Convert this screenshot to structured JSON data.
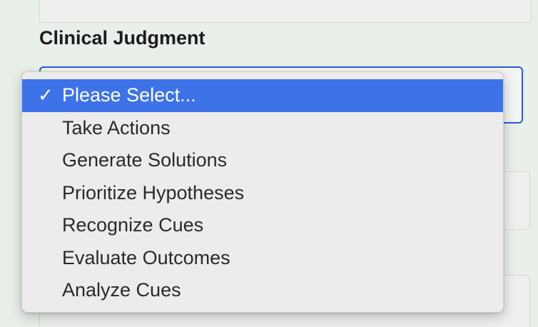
{
  "form": {
    "section_label": "Clinical Judgment"
  },
  "dropdown": {
    "selected_index": 0,
    "options": [
      {
        "label": "Please Select...",
        "selected": true
      },
      {
        "label": "Take Actions",
        "selected": false
      },
      {
        "label": "Generate Solutions",
        "selected": false
      },
      {
        "label": "Prioritize Hypotheses",
        "selected": false
      },
      {
        "label": "Recognize Cues",
        "selected": false
      },
      {
        "label": "Evaluate Outcomes",
        "selected": false
      },
      {
        "label": "Analyze Cues",
        "selected": false
      }
    ]
  },
  "icons": {
    "selected_marker": "checkmark-icon",
    "selected_marker_glyph": "✓"
  },
  "colors": {
    "accent": "#3d72e8",
    "focus_border": "#2a5bd7",
    "background": "#e9efe9"
  }
}
